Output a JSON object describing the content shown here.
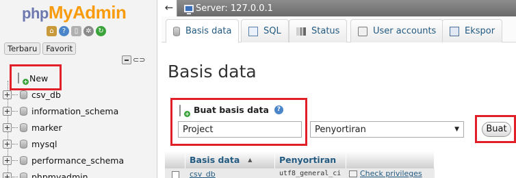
{
  "sidebar": {
    "logo": {
      "part1": "php",
      "part2": "MyAdmin"
    },
    "quick_icons": [
      "home-icon",
      "info-icon",
      "docs-icon",
      "settings-icon",
      "reload-icon"
    ],
    "tabs": {
      "recent": "Terbaru",
      "favorites": "Favorit"
    },
    "tree": {
      "new_label": "New",
      "databases": [
        "csv_db",
        "information_schema",
        "marker",
        "mysql",
        "performance_schema",
        "phpmyadmin"
      ]
    }
  },
  "topbar": {
    "server": "Server: 127.0.0.1"
  },
  "nav_tabs": [
    {
      "label": "Basis data",
      "icon": "database-icon",
      "active": true
    },
    {
      "label": "SQL",
      "icon": "sql-icon",
      "active": false
    },
    {
      "label": "Status",
      "icon": "status-icon",
      "active": false
    },
    {
      "label": "User accounts",
      "icon": "users-icon",
      "active": false
    },
    {
      "label": "Ekspor",
      "icon": "export-icon",
      "active": false
    }
  ],
  "main": {
    "title": "Basis data",
    "create": {
      "label": "Buat basis data",
      "name_value": "Project",
      "collation_selected": "Penyortiran",
      "button_label": "Buat"
    },
    "table": {
      "headers": {
        "name": "Basis data",
        "collation": "Penyortiran"
      },
      "rows": [
        {
          "name": "csv_db",
          "collation": "utf8_general_ci",
          "action": "Check privileges"
        }
      ]
    }
  },
  "colors": {
    "highlight": "#e11f28",
    "link": "#235a81",
    "logo_php": "#6c78af",
    "logo_myadmin": "#f89c0e",
    "topbar": "#7a7a7a"
  }
}
